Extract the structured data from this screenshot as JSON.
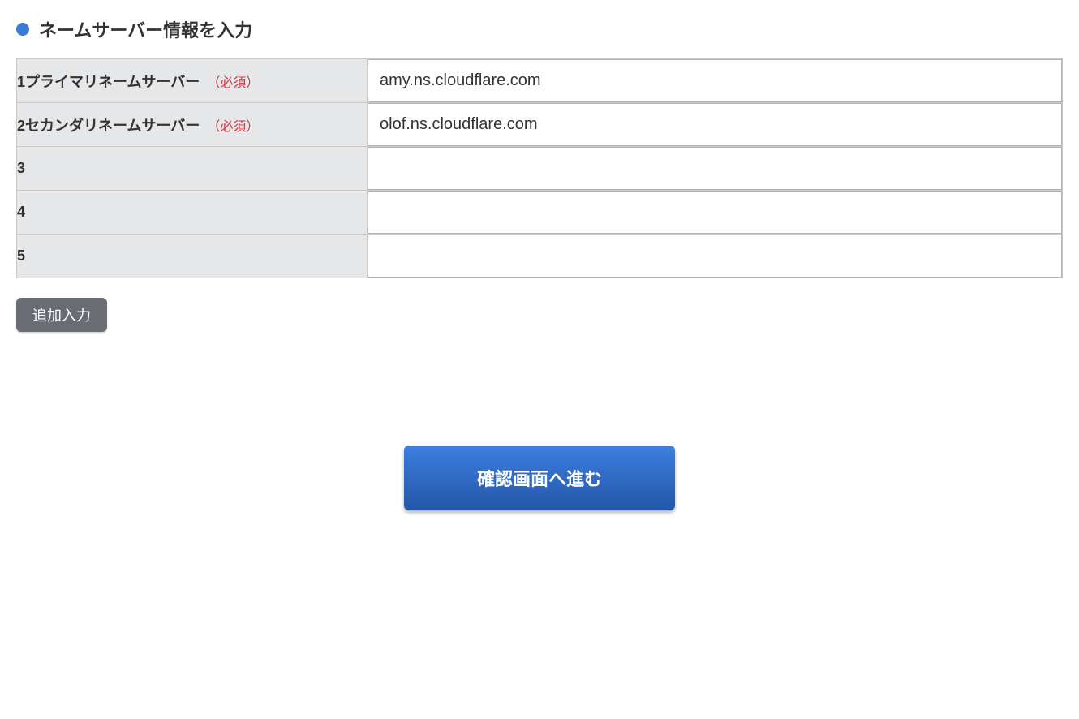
{
  "header": {
    "title": "ネームサーバー情報を入力"
  },
  "rows": [
    {
      "label": "1プライマリネームサーバー",
      "required": "（必須）",
      "value": "amy.ns.cloudflare.com"
    },
    {
      "label": "2セカンダリネームサーバー",
      "required": "（必須）",
      "value": "olof.ns.cloudflare.com"
    },
    {
      "label": "3",
      "required": "",
      "value": ""
    },
    {
      "label": "4",
      "required": "",
      "value": ""
    },
    {
      "label": "5",
      "required": "",
      "value": ""
    }
  ],
  "buttons": {
    "add": "追加入力",
    "submit": "確認画面へ進む"
  }
}
